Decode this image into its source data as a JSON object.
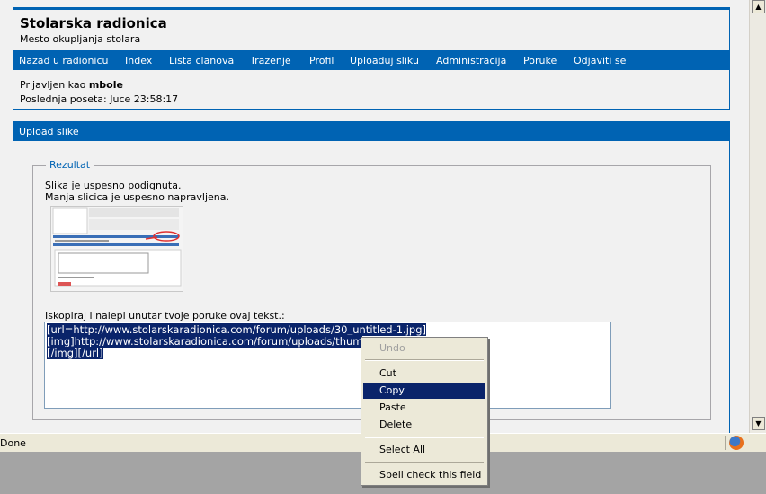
{
  "header": {
    "title": "Stolarska radionica",
    "subtitle": "Mesto okupljanja stolara",
    "nav": [
      {
        "label": "Nazad u radionicu"
      },
      {
        "label": "Index"
      },
      {
        "label": "Lista clanova"
      },
      {
        "label": "Trazenje"
      },
      {
        "label": "Profil"
      },
      {
        "label": "Uploaduj sliku"
      },
      {
        "label": "Administracija"
      },
      {
        "label": "Poruke"
      },
      {
        "label": "Odjaviti se"
      }
    ],
    "logged_in_prefix": "Prijavljen kao",
    "username": "mbole",
    "last_visit": "Poslednja poseta: Juce 23:58:17"
  },
  "upload": {
    "title": "Upload slike",
    "legend": "Rezultat",
    "message_uploaded": "Slika je uspesno podignuta.",
    "message_thumbnail": "Manja slicica je uspesno napravljena.",
    "copy_instruction": "Iskopiraj i nalepi unutar tvoje poruke ovaj tekst.:",
    "code_lines": [
      "[url=http://www.stolarskaradionica.com/forum/uploads/30_untitled-1.jpg]",
      "[img]http://www.stolarskaradionica.com/forum/uploads/thum",
      "[/img][/url]"
    ]
  },
  "context_menu": {
    "items": [
      {
        "label": "Undo",
        "enabled": false
      },
      {
        "label": "Cut",
        "enabled": true
      },
      {
        "label": "Copy",
        "enabled": true,
        "highlighted": true
      },
      {
        "label": "Paste",
        "enabled": true
      },
      {
        "label": "Delete",
        "enabled": true
      },
      {
        "label": "Select All",
        "enabled": true
      },
      {
        "label": "Spell check this field",
        "enabled": true
      }
    ]
  },
  "status": {
    "text": "Done"
  },
  "colors": {
    "brand_blue": "#0063b3",
    "selection": "#0a246a",
    "page_bg": "#f1f1f1"
  }
}
